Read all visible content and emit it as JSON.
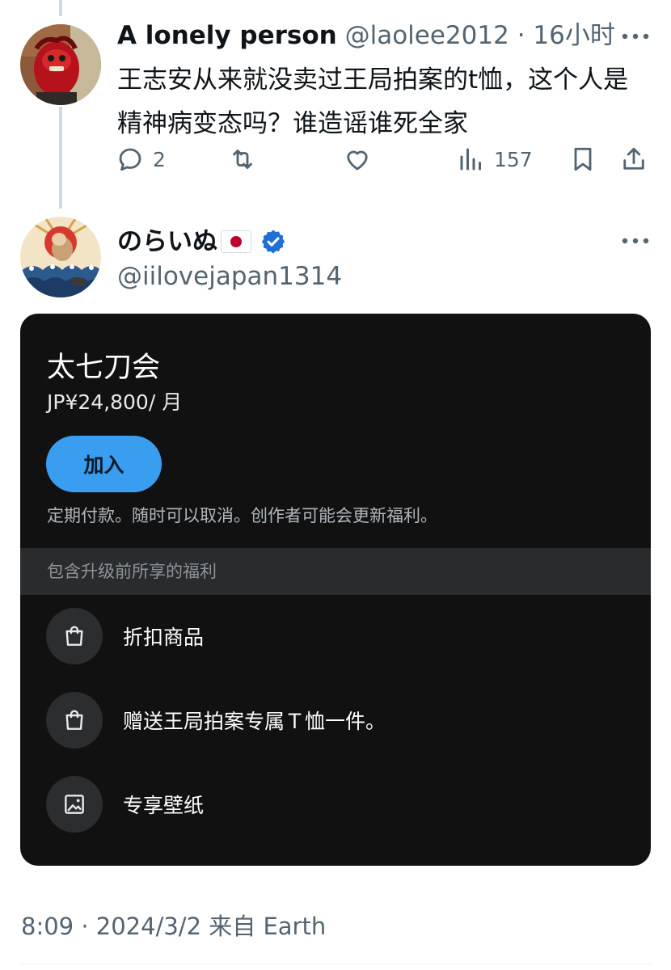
{
  "tweet1": {
    "display_name": "A lonely person",
    "handle": "@laolee2012",
    "separator": "·",
    "time": "16小时",
    "text": "王志安从来就没卖过王局拍案的t恤，这个人是精神病变态吗？谁造谣谁死全家",
    "actions": {
      "reply_count": "2",
      "retweet_count": "",
      "like_count": "",
      "views_count": "157"
    },
    "avatar_icon": "red-lion-statue-avatar"
  },
  "tweet2": {
    "display_name": "のらいぬ",
    "flag_icon": "japan-flag-icon",
    "verified_icon": "verified-badge-icon",
    "handle": "@iilovejapan1314",
    "avatar_icon": "dog-wave-art-avatar"
  },
  "subscription_card": {
    "title": "太七刀会",
    "price": "JP¥24,800/ 月",
    "join_label": "加入",
    "note": "定期付款。随时可以取消。创作者可能会更新福利。",
    "benefits_header": "包含升级前所享的福利",
    "benefits": [
      {
        "icon": "shopping-bag-icon",
        "label": "折扣商品"
      },
      {
        "icon": "shopping-bag-icon",
        "label": "赠送王局拍案专属Ｔ恤一件。"
      },
      {
        "icon": "image-icon",
        "label": "专享壁纸"
      }
    ]
  },
  "footer": {
    "timestamp": "8:09 · 2024/3/2 来自 Earth"
  },
  "colors": {
    "text_primary": "#0f1419",
    "text_secondary": "#536471",
    "card_background": "#111111",
    "join_button": "#3a9ef0",
    "verified_blue": "#1d6fd6",
    "flag_red": "#bc002d"
  }
}
